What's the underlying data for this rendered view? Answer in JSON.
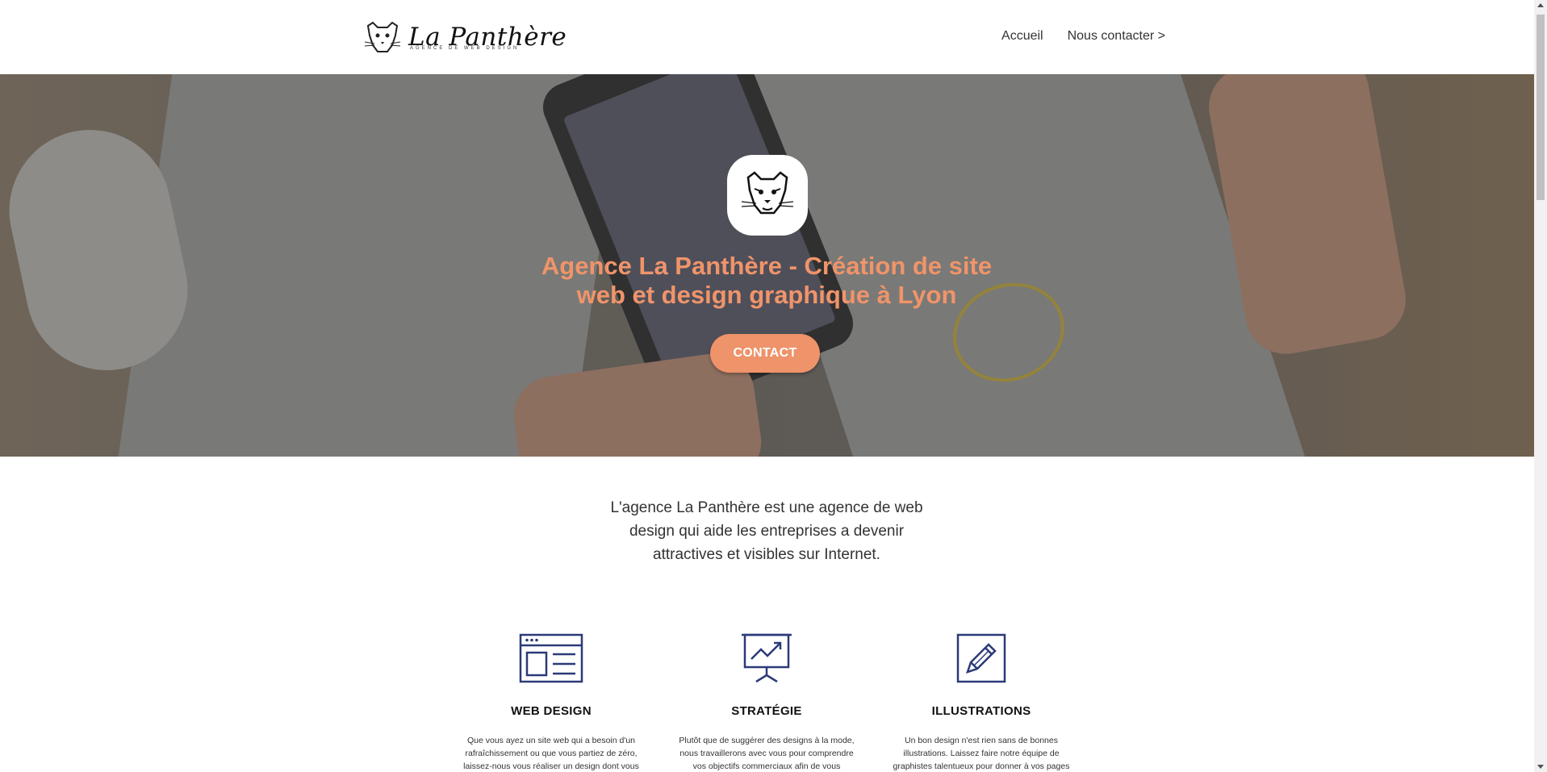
{
  "header": {
    "logo_name": "La Panthère",
    "logo_tagline": "AGENCE DE WEB DESIGN",
    "nav": [
      {
        "label": "Accueil"
      },
      {
        "label": "Nous contacter >"
      }
    ]
  },
  "hero": {
    "title": "Agence La Panthère - Création de site web et design graphique à Lyon",
    "cta_label": "CONTACT"
  },
  "intro": {
    "text": "L'agence La Panthère est une agence de web design qui aide les entreprises a devenir attractives et visibles sur Internet."
  },
  "services": [
    {
      "icon": "web-design-icon",
      "title": "WEB DESIGN",
      "text": "Que vous ayez un site web qui a besoin d'un rafraîchissement ou que vous partiez de zéro, laissez-nous vous réaliser un design dont vous"
    },
    {
      "icon": "strategy-chart-icon",
      "title": "STRATÉGIE",
      "text": "Plutôt que de suggérer des designs à la mode, nous travaillerons avec vous pour comprendre vos objectifs commerciaux afin de vous"
    },
    {
      "icon": "pencil-icon",
      "title": "ILLUSTRATIONS",
      "text": "Un bon design n'est rien sans de bonnes illustrations. Laissez faire notre équipe de graphistes talentueux pour donner à vos pages"
    }
  ],
  "colors": {
    "accent": "#ee936a",
    "hero_title": "#f0946a",
    "icon_navy": "#2b3a78"
  }
}
